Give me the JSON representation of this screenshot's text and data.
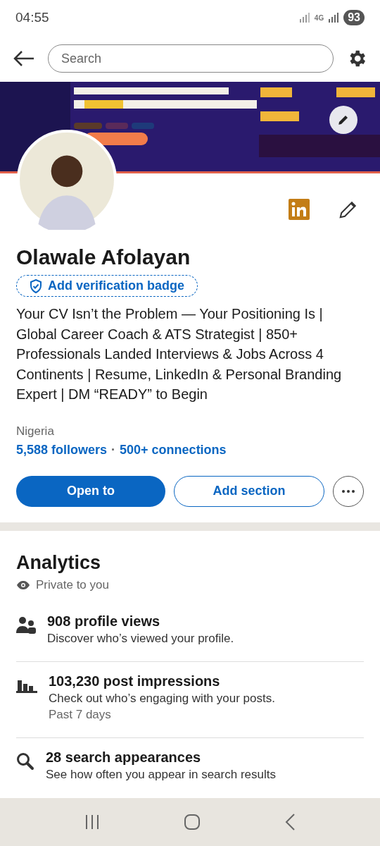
{
  "status_bar": {
    "time": "04:55",
    "network": "4G",
    "battery": "93"
  },
  "search": {
    "placeholder": "Search"
  },
  "profile": {
    "name": "Olawale Afolayan",
    "verification": "Add verification badge",
    "headline": "Your CV Isn’t the Problem — Your Positioning Is | Global Career Coach & ATS Strategist | 850+ Professionals Landed Interviews & Jobs Across 4 Continents | Resume, LinkedIn & Personal Branding Expert | DM “READY” to Begin",
    "location": "Nigeria",
    "followers": "5,588 followers",
    "separator": "·",
    "connections": "500+ connections"
  },
  "actions": [
    {
      "label": "Open to",
      "kind": "primary"
    },
    {
      "label": "Add section",
      "kind": "secondary"
    }
  ],
  "analytics": {
    "title": "Analytics",
    "privacy": "Private to you",
    "items": [
      {
        "kind": "views",
        "title": "908 profile views",
        "description": "Discover who’s viewed your profile."
      },
      {
        "kind": "impressions",
        "title": "103,230 post impressions",
        "description": "Check out who’s engaging with your posts.",
        "note": "Past 7 days"
      },
      {
        "kind": "search",
        "title": "28 search appearances",
        "description": "See how often you appear in search results"
      }
    ]
  }
}
